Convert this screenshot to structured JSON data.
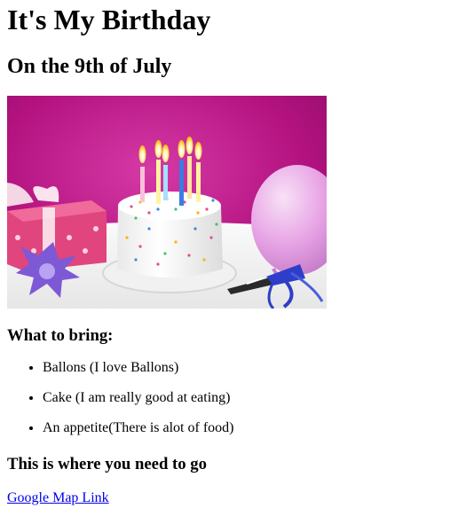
{
  "page": {
    "title": "It's My Birthday",
    "subtitle": "On the 9th of July"
  },
  "hero_image": {
    "alt": "Birthday cake with candles, gift and balloon"
  },
  "bring": {
    "heading": "What to bring:",
    "items": [
      "Ballons (I love Ballons)",
      "Cake (I am really good at eating)",
      "An appetite(There is alot of food)"
    ]
  },
  "location": {
    "heading": "This is where you need to go",
    "link_text": "Google Map Link"
  },
  "colors": {
    "link": "#0000ee",
    "backdrop": "#b3127f",
    "table": "#f3f3f3"
  }
}
